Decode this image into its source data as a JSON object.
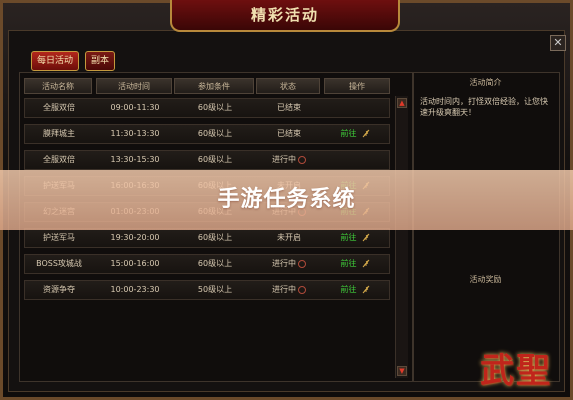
{
  "window": {
    "title": "精彩活动",
    "close_label": "✕"
  },
  "tabs": [
    {
      "label": "每日活动"
    },
    {
      "label": "副本"
    }
  ],
  "table": {
    "headers": [
      "活动名称",
      "活动时间",
      "参加条件",
      "状态",
      "操作"
    ],
    "rows": [
      {
        "name": "全服双倍",
        "time": "09:00-11:30",
        "cond": "60级以上",
        "status": "已结束",
        "action": ""
      },
      {
        "name": "膜拜城主",
        "time": "11:30-13:30",
        "cond": "60级以上",
        "status": "已结束",
        "action": "前往"
      },
      {
        "name": "全服双倍",
        "time": "13:30-15:30",
        "cond": "60级以上",
        "status": "进行中",
        "action": ""
      },
      {
        "name": "护送军马",
        "time": "16:00-16:30",
        "cond": "60级以上",
        "status": "未开启",
        "action": "前往"
      },
      {
        "name": "幻之迷宫",
        "time": "01:00-23:00",
        "cond": "60级以上",
        "status": "进行中",
        "action": "前往"
      },
      {
        "name": "护送军马",
        "time": "19:30-20:00",
        "cond": "60级以上",
        "status": "未开启",
        "action": "前往"
      },
      {
        "name": "BOSS攻城战",
        "time": "15:00-16:00",
        "cond": "60级以上",
        "status": "进行中",
        "action": "前往"
      },
      {
        "name": "资源争夺",
        "time": "10:00-23:30",
        "cond": "50级以上",
        "status": "进行中",
        "action": "前往"
      }
    ]
  },
  "detail": {
    "title": "活动简介",
    "text": "活动时间内，打怪双倍经验，让您快速升级爽翻天！",
    "reward_title": "活动奖励"
  },
  "banner": {
    "text": "手游任务系统"
  },
  "logo": {
    "text": "武聖"
  },
  "colors": {
    "accent": "#b3271c",
    "gold": "#c49a3e",
    "go_green": "#3fcf3a"
  }
}
